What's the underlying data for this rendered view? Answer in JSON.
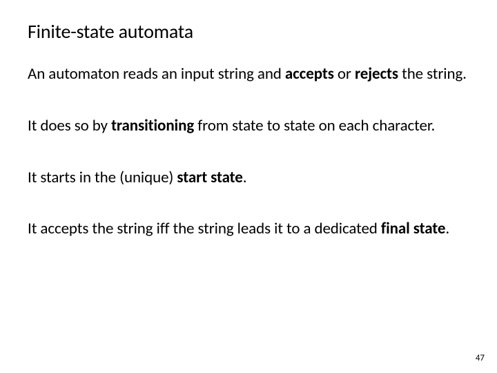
{
  "title": "Finite-state automata",
  "p1": {
    "t1": "An automaton reads an input string and ",
    "b1": "accepts",
    "t2": " or ",
    "b2": "rejects",
    "t3": " the string."
  },
  "p2": {
    "t1": "It does so by ",
    "b1": "transitioning",
    "t2": " from state to state on each character."
  },
  "p3": {
    "t1": "It starts in the (unique) ",
    "b1": "start state",
    "t2": "."
  },
  "p4": {
    "t1": "It accepts the string iff the string leads it to a dedicated ",
    "b1": "final state",
    "t2": "."
  },
  "page_number": "47"
}
